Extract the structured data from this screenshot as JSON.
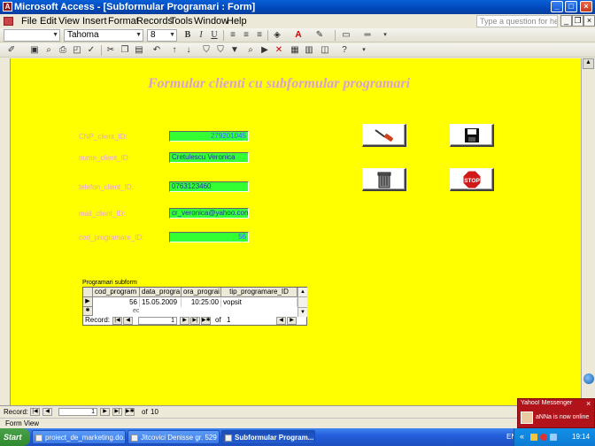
{
  "window": {
    "title": "Microsoft Access - [Subformular Programari : Form]",
    "controls": [
      "_",
      "□",
      "×"
    ]
  },
  "menu": {
    "items": [
      "File",
      "Edit",
      "View",
      "Insert",
      "Format",
      "Records",
      "Tools",
      "Window",
      "Help"
    ],
    "help_placeholder": "Type a question for help"
  },
  "format_toolbar": {
    "object_combo": "",
    "font_name": "Tahoma",
    "font_size": "8",
    "bold": "B",
    "italic": "I",
    "underline": "U"
  },
  "form": {
    "background": "#ffff00",
    "title": "Formular clienti cu subformular programari",
    "fields": [
      {
        "label": "CNP_client_ID:",
        "value": "279201045",
        "align": "right"
      },
      {
        "label": "nume_client_ID:",
        "value": "Cretulescu Veronica",
        "align": "left"
      },
      {
        "label": "telefon_client_ID:",
        "value": "0763123460",
        "align": "left"
      },
      {
        "label": "mail_client_ID:",
        "value": "cr_veronica@yahoo.com",
        "align": "left"
      },
      {
        "label": "cod_programare_ID:",
        "value": "56",
        "align": "right"
      }
    ],
    "buttons": [
      {
        "name": "edit-record",
        "icon": "screwdriver-icon"
      },
      {
        "name": "save-record",
        "icon": "floppy-disk-icon"
      },
      {
        "name": "delete-record",
        "icon": "trash-can-icon"
      },
      {
        "name": "stop",
        "icon": "stop-sign-icon",
        "label": "STOP"
      }
    ]
  },
  "subform": {
    "label": "Programari subform",
    "columns": [
      "cod_program",
      "data_progra",
      "ora_prograi",
      "tip_programare_ID"
    ],
    "rows": [
      [
        "56",
        "15.05.2009",
        "10:25:00",
        "vopsit"
      ]
    ],
    "new_row_marker": "ec",
    "nav": {
      "label": "Record:",
      "current": "1",
      "of": "of",
      "total": "1"
    }
  },
  "main_nav": {
    "label": "Record:",
    "current": "1",
    "of": "of",
    "total": "10"
  },
  "status": {
    "text": "Form View"
  },
  "taskbar": {
    "start": "Start",
    "tasks": [
      {
        "label": "proiect_de_marketing.do..."
      },
      {
        "label": "Jitcovici Denisse gr. 529 ..."
      },
      {
        "label": "Subformular Program..."
      }
    ],
    "lang": "EN",
    "clock": "19:14"
  },
  "yahoo_popup": {
    "title": "Yahoo! Messenger",
    "message": "aNNa is now online"
  },
  "colors": {
    "label": "#e8a0e0",
    "field_bg": "#33ff33",
    "title": "#d99fd8"
  }
}
